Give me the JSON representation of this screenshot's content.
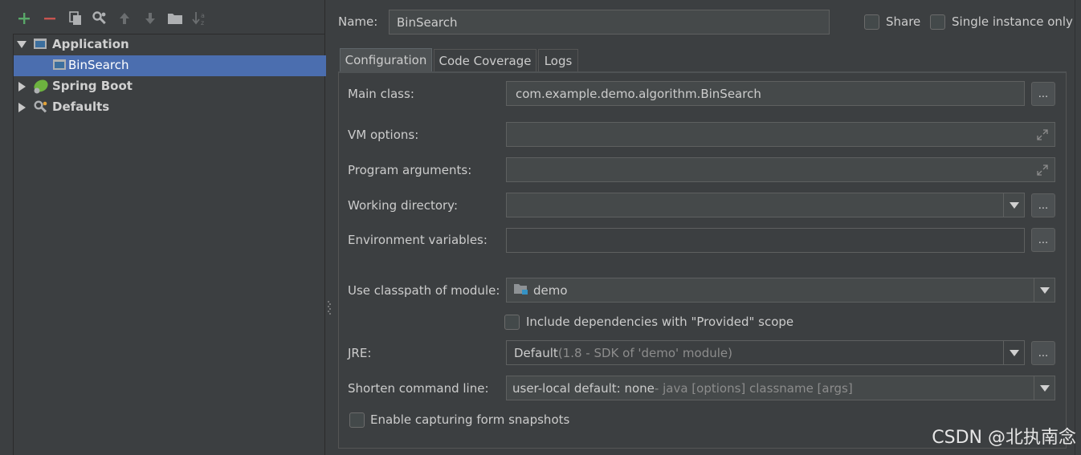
{
  "tree": {
    "items": [
      {
        "label": "Application",
        "expanded": true,
        "icon": "application-config-icon"
      },
      {
        "label": "BinSearch",
        "selected": true,
        "icon": "java-class-config-icon"
      },
      {
        "label": "Spring Boot",
        "expanded": false,
        "icon": "spring-boot-icon"
      },
      {
        "label": "Defaults",
        "expanded": false,
        "icon": "wrench-icon"
      }
    ]
  },
  "toolbar": {
    "icons": [
      "add-icon",
      "remove-icon",
      "copy-icon",
      "wrench-icon",
      "move-up-icon",
      "move-down-icon",
      "folder-icon",
      "sort-icon"
    ]
  },
  "header": {
    "name_label": "Name:",
    "name_value": "BinSearch",
    "share_label": "Share",
    "single_instance_label": "Single instance only"
  },
  "tabs": [
    {
      "label": "Configuration",
      "active": true
    },
    {
      "label": "Code Coverage",
      "active": false
    },
    {
      "label": "Logs",
      "active": false
    }
  ],
  "form": {
    "main_class_label": "Main class:",
    "main_class_value": "com.example.demo.algorithm.BinSearch",
    "vm_options_label": "VM options:",
    "vm_options_value": "",
    "program_args_label": "Program arguments:",
    "program_args_value": "",
    "working_dir_label": "Working directory:",
    "working_dir_value": "",
    "env_vars_label": "Environment variables:",
    "env_vars_value": "",
    "module_label": "Use classpath of module:",
    "module_value": "demo",
    "include_provided_label": "Include dependencies with \"Provided\" scope",
    "jre_label": "JRE:",
    "jre_value_main": "Default",
    "jre_value_hint": " (1.8 - SDK of 'demo' module)",
    "shorten_label": "Shorten command line:",
    "shorten_value_main": "user-local default: none",
    "shorten_value_hint": " - java [options] classname [args]",
    "snapshots_label": "Enable capturing form snapshots",
    "browse_label": "..."
  },
  "watermark": "CSDN @北执南念",
  "colors": {
    "background": "#3c3f41",
    "selection": "#4b6eaf",
    "field": "#45494a",
    "add_green": "#59a869",
    "remove_red": "#c75450"
  }
}
